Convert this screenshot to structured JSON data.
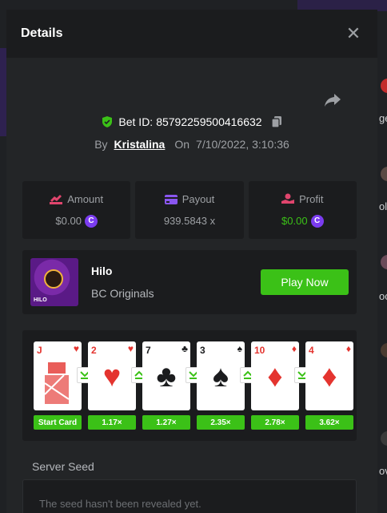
{
  "modal": {
    "title": "Details",
    "bet": {
      "label": "Bet ID:",
      "id": "85792259500416632",
      "by_label": "By",
      "user": "Kristalina",
      "on_label": "On",
      "date": "7/10/2022, 3:10:36"
    },
    "stats": [
      {
        "label": "Amount",
        "value": "$0.00",
        "icon": "amount-icon",
        "color": "#e0456d"
      },
      {
        "label": "Payout",
        "value": "939.5843 x",
        "icon": "payout-icon",
        "color": "#8a56f0"
      },
      {
        "label": "Profit",
        "value": "$0.00",
        "icon": "profit-icon",
        "color": "#e0456d"
      }
    ],
    "game": {
      "name": "Hilo",
      "provider": "BC Originals",
      "thumb_label": "HILO",
      "play_label": "Play Now"
    },
    "cards": [
      {
        "rank": "J",
        "suit": "♥",
        "color": "red",
        "mult": "Start Card",
        "arrow": null
      },
      {
        "rank": "2",
        "suit": "♥",
        "color": "red",
        "mult": "1.17×",
        "arrow": "down"
      },
      {
        "rank": "7",
        "suit": "♣",
        "color": "black",
        "mult": "1.27×",
        "arrow": "up"
      },
      {
        "rank": "3",
        "suit": "♠",
        "color": "black",
        "mult": "2.35×",
        "arrow": "down"
      },
      {
        "rank": "10",
        "suit": "♦",
        "color": "red",
        "mult": "2.78×",
        "arrow": "up"
      },
      {
        "rank": "4",
        "suit": "♦",
        "color": "red",
        "mult": "3.62×",
        "arrow": "down"
      }
    ],
    "server_seed": {
      "label": "Server Seed",
      "text": "The seed hasn't been revealed yet."
    }
  },
  "background": {
    "right_texts": [
      "ge",
      "ol",
      "oc",
      "ov"
    ]
  },
  "colors": {
    "accent_green": "#3bc117",
    "coin_purple": "#7b3cf0",
    "card_red": "#e4342f"
  }
}
